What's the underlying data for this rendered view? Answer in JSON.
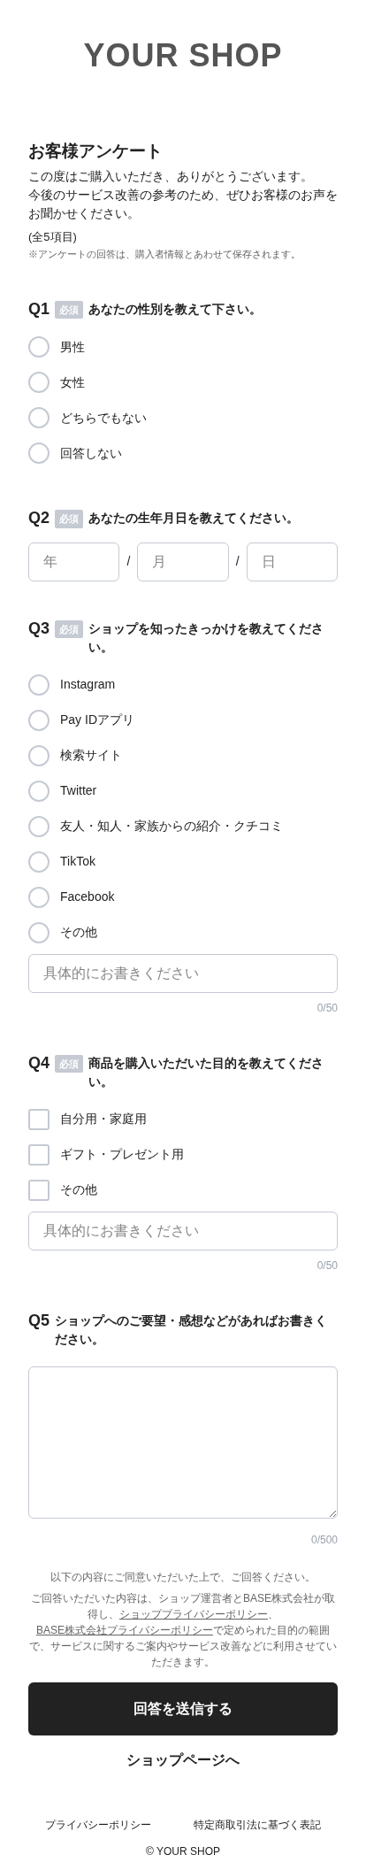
{
  "header": {
    "logo": "YOUR SHOP"
  },
  "intro": {
    "title": "お客様アンケート",
    "lines": [
      "この度はご購入いただき、ありがとうございます。",
      "今後のサービス改善の参考のため、ぜひお客様のお声をお聞かせください。"
    ],
    "count": "(全5項目)",
    "note": "※アンケートの回答は、購入者情報とあわせて保存されます。"
  },
  "questions": [
    {
      "number": "Q1",
      "badge": "必須",
      "text": "あなたの性別を教えて下さい。",
      "kind": "radio",
      "options": [
        {
          "label": "男性",
          "selected": false
        },
        {
          "label": "女性",
          "selected": false
        },
        {
          "label": "どちらでもない",
          "selected": false
        },
        {
          "label": "回答しない",
          "selected": false
        }
      ]
    },
    {
      "number": "Q2",
      "badge": "必須",
      "text": "あなたの生年月日を教えてください。",
      "kind": "date",
      "fields": [
        {
          "placeholder": "年"
        },
        {
          "placeholder": "月"
        },
        {
          "placeholder": "日"
        }
      ],
      "separators": [
        "/",
        "/"
      ]
    },
    {
      "number": "Q3",
      "badge": "必須",
      "text": "ショップを知ったきっかけを教えてください。",
      "kind": "radio",
      "options": [
        {
          "label": "Instagram",
          "selected": false
        },
        {
          "label": "Pay IDアプリ",
          "selected": false
        },
        {
          "label": "検索サイト",
          "selected": false
        },
        {
          "label": "Twitter",
          "selected": false
        },
        {
          "label": "友人・知人・家族からの紹介・クチコミ",
          "selected": false
        },
        {
          "label": "TikTok",
          "selected": false
        },
        {
          "label": "Facebook",
          "selected": false
        },
        {
          "label": "その他",
          "selected": false
        }
      ],
      "other": {
        "placeholder": "具体的にお書きください",
        "counter": "0/50"
      }
    },
    {
      "number": "Q4",
      "badge": "必須",
      "text": "商品を購入いただいた目的を教えてください。",
      "kind": "checkbox",
      "options": [
        {
          "label": "自分用・家庭用",
          "checked": false
        },
        {
          "label": "ギフト・プレゼント用",
          "checked": false
        },
        {
          "label": "その他",
          "checked": false
        }
      ],
      "other": {
        "placeholder": "具体的にお書きください",
        "counter": "0/50"
      }
    },
    {
      "number": "Q5",
      "text": "ショップへのご要望・感想などがあればお書きください。",
      "kind": "textarea",
      "counter": "0/500"
    }
  ],
  "consent": {
    "lead": "以下の内容にご同意いただいた上で、ご回答ください。",
    "parts": [
      {
        "kind": "text",
        "text": "ご回答いただいた内容は、ショップ運営者とBASE株式会社が取得し、"
      },
      {
        "kind": "link",
        "text": "ショッププライバシーポリシー"
      },
      {
        "kind": "text",
        "text": "、"
      },
      {
        "kind": "link",
        "text": "BASE株式会社プライバシーポリシー"
      },
      {
        "kind": "text",
        "text": "で定められた目的の範囲で、サービスに関するご案内やサービス改善などに利用させていただきます。"
      }
    ]
  },
  "submit_button": "回答を送信する",
  "shop_link": "ショップページへ",
  "footer": {
    "links": [
      "プライバシーポリシー",
      "特定商取引法に基づく表記"
    ],
    "copyright": "© YOUR SHOP"
  }
}
